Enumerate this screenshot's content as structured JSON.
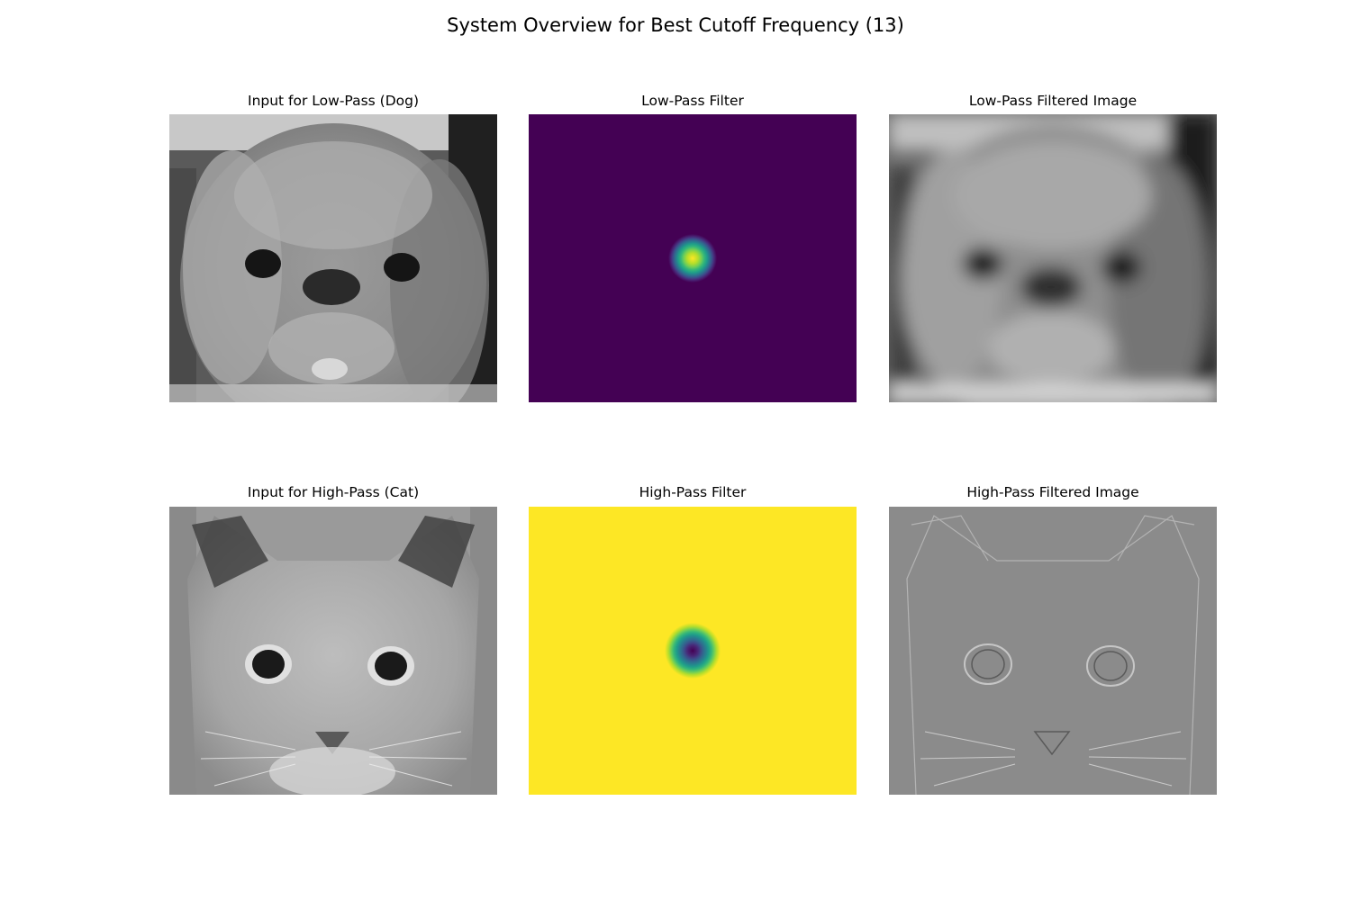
{
  "figure": {
    "title": "System Overview for Best Cutoff Frequency (13)"
  },
  "panels": {
    "dog_input": {
      "title": "Input for Low-Pass (Dog)",
      "image": "grayscale-dog-photo"
    },
    "low_pass_filter": {
      "title": "Low-Pass Filter",
      "image": "gaussian-low-pass-mask"
    },
    "low_pass_output": {
      "title": "Low-Pass Filtered Image",
      "image": "blurred-dog-photo"
    },
    "cat_input": {
      "title": "Input for High-Pass (Cat)",
      "image": "grayscale-cat-photo"
    },
    "high_pass_filter": {
      "title": "High-Pass Filter",
      "image": "gaussian-high-pass-mask"
    },
    "high_pass_output": {
      "title": "High-Pass Filtered Image",
      "image": "edge-detail-cat-photo"
    }
  },
  "colors": {
    "viridis_low": "#440154",
    "viridis_high": "#fde725"
  }
}
